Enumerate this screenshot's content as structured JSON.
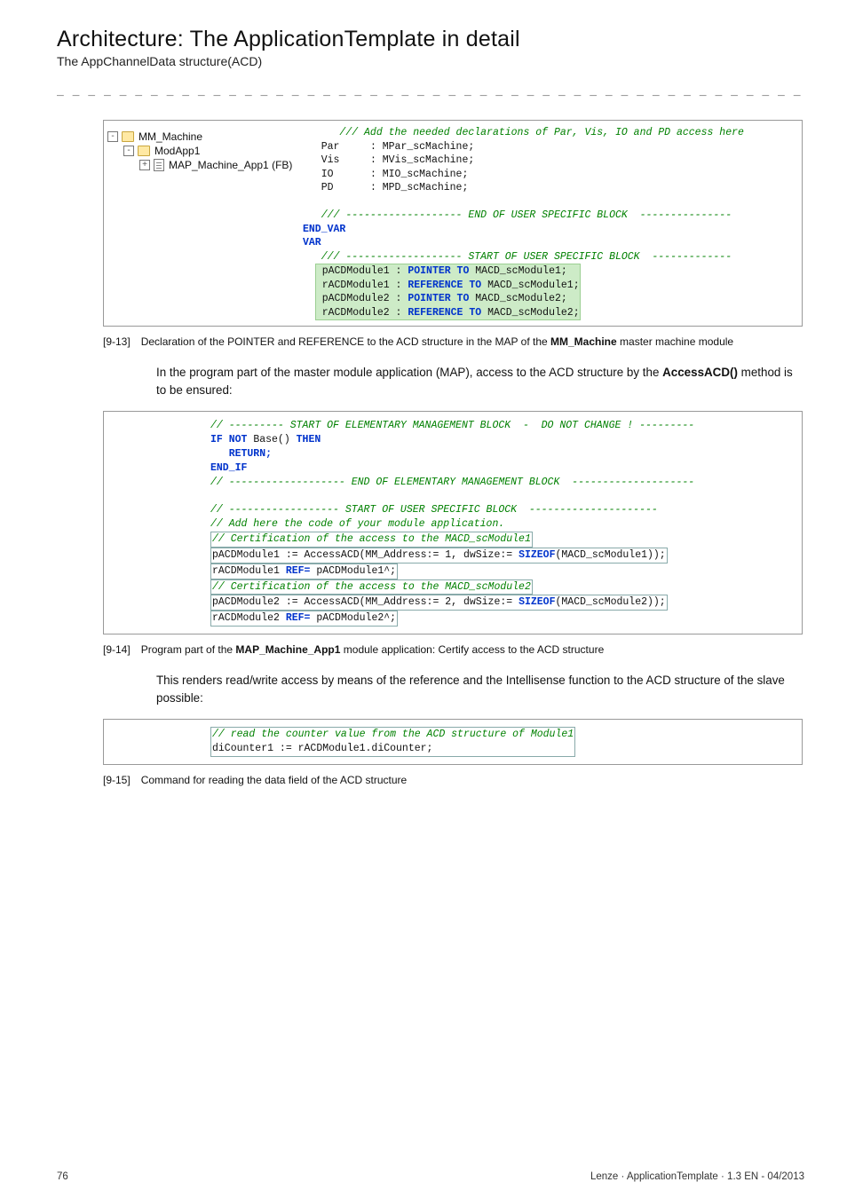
{
  "title": "Architecture: The ApplicationTemplate in detail",
  "subtitle": "The AppChannelData structure(ACD)",
  "dashline": "_ _ _ _ _ _ _ _ _ _ _ _ _ _ _ _ _ _ _ _ _ _ _ _ _ _ _ _ _ _ _ _ _ _ _ _ _ _ _ _ _ _ _ _ _ _ _ _ _ _ _ _ _ _ _ _ _ _ _ _ _ _ _ _",
  "tree": {
    "item1": "MM_Machine",
    "item2": "ModApp1",
    "item3": "MAP_Machine_App1 (FB)"
  },
  "code1": {
    "topcomment": "/// Add the needed declarations of Par, Vis, IO and PD access here",
    "par_kw": "Par",
    "par_decl": "     : MPar_scMachine;",
    "vis_kw": "Vis",
    "vis_decl": "     : MVis_scMachine;",
    "io_kw": "IO",
    "io_decl": "      : MIO_scMachine;",
    "pd_kw": "PD",
    "pd_decl": "      : MPD_scMachine;",
    "endblk": "/// ------------------- END OF USER SPECIFIC BLOCK  ---------------",
    "endvar": "END_VAR",
    "var": "VAR",
    "startblk": "/// ------------------- START OF USER SPECIFIC BLOCK  -------------",
    "p1a": "pACDModule1 : ",
    "p1b": "POINTER TO",
    "p1c": " MACD_scModule1;",
    "r1a": "rACDModule1 : ",
    "r1b": "REFERENCE TO",
    "r1c": " MACD_scModule1;",
    "p2a": "pACDModule2 : ",
    "p2b": "POINTER TO",
    "p2c": " MACD_scModule2;",
    "r2a": "rACDModule2 : ",
    "r2b": "REFERENCE TO",
    "r2c": " MACD_scModule2;"
  },
  "cap1": {
    "tag": "[9-13]",
    "txt_a": "Declaration of the POINTER and REFERENCE to the ACD structure in the MAP of the ",
    "txt_b": "MM_Machine",
    "txt_c": " master machine module"
  },
  "para1_a": "In the program part of the master module application (MAP), access to the ACD structure by the ",
  "para1_b": "AccessACD()",
  "para1_c": " method is to be ensured:",
  "code2": {
    "l01": "// --------- START OF ELEMENTARY MANAGEMENT BLOCK  -  DO NOT CHANGE ! ---------",
    "l02a": "IF NOT",
    "l02b": " Base() ",
    "l02c": "THEN",
    "l03": "   RETURN;",
    "l04": "END_IF",
    "l05": "// ------------------- END OF ELEMENTARY MANAGEMENT BLOCK  --------------------",
    "l06": "",
    "l07": "// ------------------ START OF USER SPECIFIC BLOCK  ---------------------",
    "l08": "// Add here the code of your module application.",
    "l09": "// Certification of the access to the MACD_scModule1",
    "l10a": "pACDModule1 := AccessACD(MM_Address:= 1, dwSize:= ",
    "l10b": "SIZEOF",
    "l10c": "(MACD_scModule1));",
    "l11a": "rACDModule1 ",
    "l11b": "REF=",
    "l11c": " pACDModule1^;",
    "l12": "// Certification of the access to the MACD_scModule2",
    "l13a": "pACDModule2 := AccessACD(MM_Address:= 2, dwSize:= ",
    "l13b": "SIZEOF",
    "l13c": "(MACD_scModule2));",
    "l14a": "rACDModule2 ",
    "l14b": "REF=",
    "l14c": " pACDModule2^;"
  },
  "cap2": {
    "tag": "[9-14]",
    "txt_a": "Program part of the ",
    "txt_b": "MAP_Machine_App1",
    "txt_c": " module application: Certify access to the ACD structure"
  },
  "para2": "This renders read/write access by means of the reference and the Intellisense function to the ACD structure of the slave possible:",
  "code3": {
    "l1": "// read the counter value from the ACD structure of Module1",
    "l2": "diCounter1 := rACDModule1.diCounter;"
  },
  "cap3": {
    "tag": "[9-15]",
    "txt": "Command for reading the data field of the ACD structure"
  },
  "footer_left": "76",
  "footer_right": "Lenze · ApplicationTemplate · 1.3 EN - 04/2013"
}
